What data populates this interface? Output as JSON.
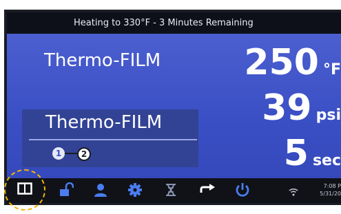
{
  "status": {
    "message": "Heating to 330°F - 3 Minutes Remaining"
  },
  "main": {
    "current_film": "Thermo-FILM",
    "program": {
      "film": "Thermo-FILM",
      "steps": [
        "1",
        "2"
      ],
      "active_step": 1
    },
    "readouts": {
      "temperature": {
        "value": "250",
        "unit": "°F"
      },
      "pressure": {
        "value": "39",
        "unit": "psi"
      },
      "time": {
        "value": "5",
        "unit": "sec"
      }
    }
  },
  "toolbar": {
    "items": [
      {
        "icon": "layout-icon"
      },
      {
        "icon": "unlock-icon"
      },
      {
        "icon": "user-icon"
      },
      {
        "icon": "gear-icon"
      },
      {
        "icon": "no-film-icon"
      },
      {
        "icon": "arrow-right-icon"
      },
      {
        "icon": "power-icon"
      }
    ],
    "time": "7:08 P",
    "date": "5/31/20"
  },
  "colors": {
    "accent": "#4b7cf0",
    "panel": "#3a4fc4",
    "highlight": "#f4b400"
  }
}
